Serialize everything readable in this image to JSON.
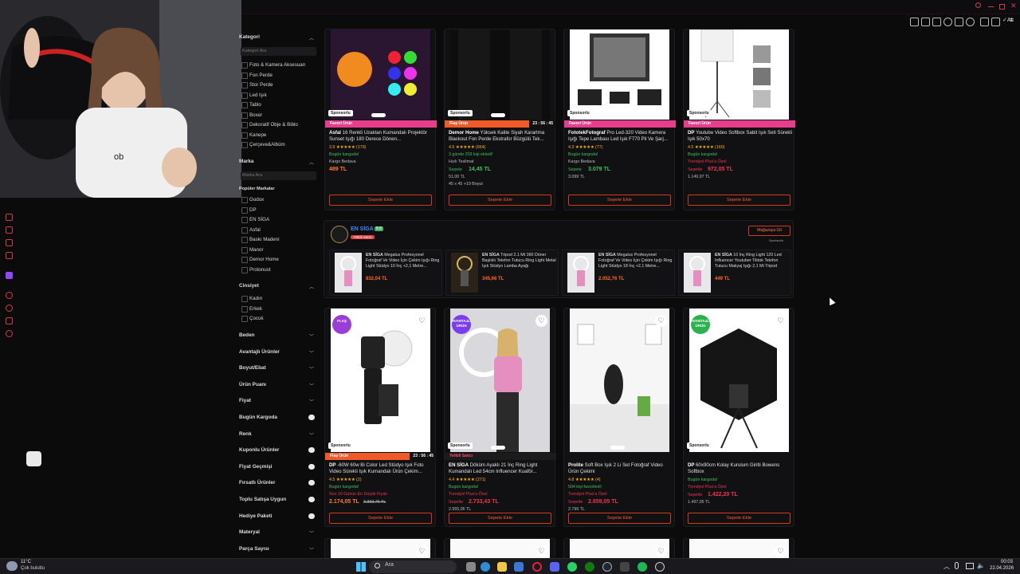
{
  "filters": {
    "category": {
      "title": "Kategori",
      "search_placeholder": "Kategori Ara",
      "items": [
        "Foto & Kamera Aksesuarı",
        "Fon Perde",
        "Stor Perde",
        "Led Işık",
        "Tablo",
        "Boxer",
        "Dekoratif Obje & Biblo",
        "Kanepe",
        "Çerçeve&Albüm"
      ]
    },
    "brand": {
      "title": "Marka",
      "search_placeholder": "Marka Ara",
      "popular_label": "Popüler Markalar",
      "items": [
        "Godox",
        "DP",
        "EN SİGA",
        "Asfal",
        "Baskı Madeni",
        "Manor",
        "Demor Home",
        "Protonust"
      ]
    },
    "gender": {
      "title": "Cinsiyet",
      "items": [
        "Kadın",
        "Erkek",
        "Çocuk"
      ]
    },
    "sections": [
      "Beden",
      "Avantajlı Ürünler",
      "Boyut/Ebat",
      "Ürün Puanı",
      "Fiyat",
      "Bugün Kargoda",
      "Renk",
      "Kuponlu Ürünler",
      "Fiyat Geçmişi",
      "Fırsatlı Ürünler",
      "Toplu Satışa Uygun",
      "Hediye Paketi",
      "Materyal",
      "Parça Sayısı"
    ]
  },
  "row1": [
    {
      "tag": "Favori Ürün",
      "tag_color": "#e83d8a",
      "title_brand": "Asfal",
      "title": "16 Renkli Uzaktan Kumandalı Projektör Sunset Işığı 180 Derece Dönen...",
      "rating": "3.9 ★★★★★ (179)",
      "ship": "Bugün kargoda!",
      "cargo": "Kargo Bedava",
      "price": "489 TL",
      "add": "Sepete Ekle"
    },
    {
      "tag": "Flaş Ürün",
      "timer": "23 : 56 : 45",
      "tag_color": "#f05a28",
      "title_brand": "Demor Home",
      "title": "Yüksek Kalite Siyah Karartma Blackout Fon Perde Ekstrafor Büzgülü Tek...",
      "rating": "4.5 ★★★★★ (664)",
      "ship": "3 günde 203 kişi ekledi!",
      "cargo": "Hızlı Teslimat",
      "price_label": "Sepete",
      "price": "14,45 TL",
      "old": "51,00 TL",
      "size": "45 x 45 +19 Boyut",
      "add": "Sepete Ekle"
    },
    {
      "tag": "Favori Ürün",
      "tag_color": "#e83d8a",
      "title_brand": "FototekFotograf",
      "title": "Pro Led-320 Video Kamera Işığı Tepe Lambası Led Işık F770 Pil Ve Şarj...",
      "rating": "4.3 ★★★★★ (77)",
      "ship": "Bugün kargoda!",
      "cargo": "Kargo Bedava",
      "price_label": "Sepete",
      "price": "3.079 TL",
      "old": "3.099 TL",
      "add": "Sepete Ekle"
    },
    {
      "tag": "Favori Ürün",
      "tag_color": "#e83d8a",
      "title_brand": "DP",
      "title": "Youtube Video Softbox Sabit Işık Seti Sürekli Işık 50x70",
      "rating": "4.5 ★★★★★ (160)",
      "ship": "Bugün kargoda!",
      "cargo": "Trendyol Plus'a Özel",
      "price_label": "Sepette",
      "price": "972,05 TL",
      "old": "1.149,97 TL",
      "add": "Sepete Ekle"
    }
  ],
  "store": {
    "name": "EN SİGA",
    "rating": "8.8",
    "badge": "Yetkili Satıcı",
    "visit": "Mağazaya Git",
    "sponsored": "Sponsorlu",
    "items": [
      {
        "brand": "EN SİGA",
        "title": "Megalux Profesyonel Fotoğraf Ve Video İçin Çekim Işığı Ring Light Stüdyo 10 İnç +2,1 Metre...",
        "price": "832,04 TL"
      },
      {
        "brand": "EN SİGA",
        "title": "Tripod 2.1 Mt 360 Döner Başlıklı Telefon Tutucu Ring Light Metal Işık Stüdyo Lamba Ayağı",
        "price": "345,66 TL"
      },
      {
        "brand": "EN SİGA",
        "title": "Megalux Profesyonel Fotoğraf Ve Video İçin Çekim Işığı Ring Light Stüdyo 18 İnç +2,1 Metre...",
        "price": "2.052,76 TL"
      },
      {
        "brand": "EN SİGA",
        "title": "10 İnç Ring Light 120 Led Influencer Youtuber Tiktok Telefon Tutucu Makyaj Işığı 2,1 Mt Tripod",
        "price": "449 TL"
      }
    ]
  },
  "row2": [
    {
      "tag": "Flaş Ürün",
      "timer": "23 : 56 : 45",
      "title_brand": "DP",
      "title": "-60W 60w Bi Color Led Stüdyo Işık Foto Video Sürekli Işık Kumandalı Ürün Çekim...",
      "rating": "4.5 ★★★★★ (2)",
      "ship": "Bugün kargoda!",
      "note": "Son 10 Günün En Düşük Fiyatı",
      "price": "2.174,05 TL",
      "old": "2.393,76 TL",
      "add": "Sepete Ekle"
    },
    {
      "tag": "Yetkili Satıcı",
      "title_brand": "EN SİGA",
      "title": "Döküm Ayaklı 21 İnç Ring Light Kumandalı Led 54cm Influencer Kuaför...",
      "rating": "4.4 ★★★★★ (271)",
      "ship": "Bugün kargoda!",
      "cargo": "Trendyol Plus'a Özel",
      "price_label": "Sepette",
      "price": "2.733,43 TL",
      "old": "2.955,06 TL",
      "add": "Sepete Ekle"
    },
    {
      "title_brand": "Prolite",
      "title": "Soft Box Işık 2 Li Set Fotoğraf Video Ürün Çekimi",
      "rating": "4.8 ★★★★★ (4)",
      "ship": "504 kişi favoriledi!",
      "cargo": "Trendyol Plus'a Özel",
      "price_label": "Sepette",
      "price": "2.659,05 TL",
      "old": "2.799 TL",
      "add": "Sepete Ekle"
    },
    {
      "title_brand": "DP",
      "title": "60x90cm Kolay Kurulum Giritli Bowens Softbox",
      "ship": "Bugün kargoda!",
      "cargo": "Trendyol Plus'a Özel",
      "price_label": "Sepette",
      "price": "1.422,20 TL",
      "old": "1.497,05 TL",
      "add": "Sepete Ekle"
    }
  ],
  "labels": {
    "sponsored": "Sponsorlu",
    "flash_badge": "FLAŞ",
    "adv_badge": "AVANTAJLI ÜRÜN"
  },
  "taskbar": {
    "weather_temp": "11°C",
    "weather_desc": "Çok bulutlu",
    "search": "Ara",
    "time": "00:03",
    "date": "22.04.2026"
  }
}
